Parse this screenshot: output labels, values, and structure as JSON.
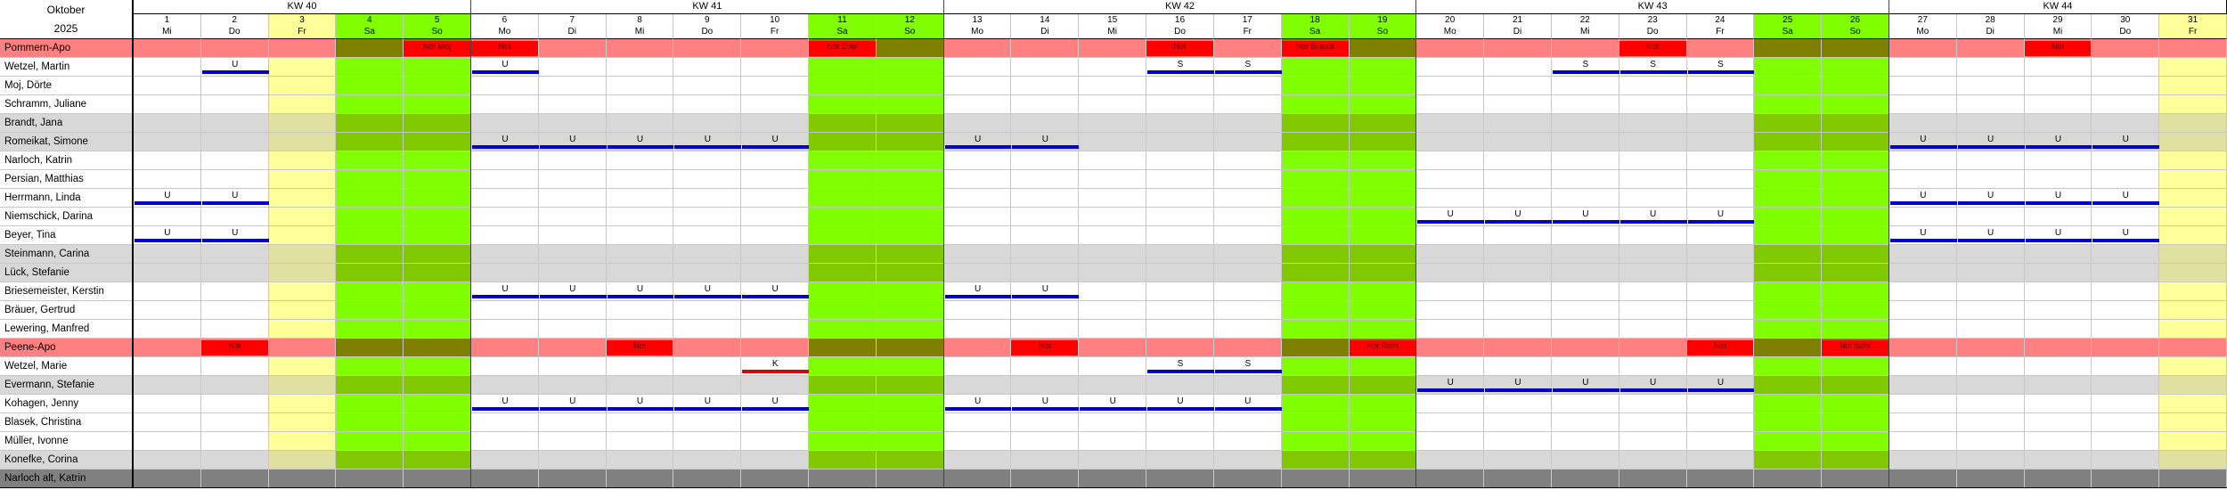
{
  "month": "Oktober",
  "year": "2025",
  "weeks": [
    {
      "label": "KW 40",
      "start": 0,
      "span": 5
    },
    {
      "label": "KW 41",
      "start": 5,
      "span": 7
    },
    {
      "label": "KW 42",
      "start": 12,
      "span": 7
    },
    {
      "label": "KW 43",
      "start": 19,
      "span": 7
    },
    {
      "label": "KW 44",
      "start": 26,
      "span": 5
    }
  ],
  "days": [
    {
      "n": "1",
      "w": "Mi"
    },
    {
      "n": "2",
      "w": "Do"
    },
    {
      "n": "3",
      "w": "Fr",
      "t": "hol"
    },
    {
      "n": "4",
      "w": "Sa",
      "t": "we"
    },
    {
      "n": "5",
      "w": "So",
      "t": "we"
    },
    {
      "n": "6",
      "w": "Mo"
    },
    {
      "n": "7",
      "w": "Di"
    },
    {
      "n": "8",
      "w": "Mi"
    },
    {
      "n": "9",
      "w": "Do"
    },
    {
      "n": "10",
      "w": "Fr"
    },
    {
      "n": "11",
      "w": "Sa",
      "t": "we"
    },
    {
      "n": "12",
      "w": "So",
      "t": "we"
    },
    {
      "n": "13",
      "w": "Mo"
    },
    {
      "n": "14",
      "w": "Di"
    },
    {
      "n": "15",
      "w": "Mi"
    },
    {
      "n": "16",
      "w": "Do"
    },
    {
      "n": "17",
      "w": "Fr"
    },
    {
      "n": "18",
      "w": "Sa",
      "t": "we"
    },
    {
      "n": "19",
      "w": "So",
      "t": "we"
    },
    {
      "n": "20",
      "w": "Mo"
    },
    {
      "n": "21",
      "w": "Di"
    },
    {
      "n": "22",
      "w": "Mi"
    },
    {
      "n": "23",
      "w": "Do"
    },
    {
      "n": "24",
      "w": "Fr"
    },
    {
      "n": "25",
      "w": "Sa",
      "t": "we"
    },
    {
      "n": "26",
      "w": "So",
      "t": "we"
    },
    {
      "n": "27",
      "w": "Mo"
    },
    {
      "n": "28",
      "w": "Di"
    },
    {
      "n": "29",
      "w": "Mi"
    },
    {
      "n": "30",
      "w": "Do"
    },
    {
      "n": "31",
      "w": "Fr",
      "t": "hol"
    }
  ],
  "colors": {
    "weekend": "#80ff00",
    "weekend_gray": "#80c800",
    "holiday": "#ffff99",
    "holiday_gray": "#e0e0a0",
    "group": "#ff8080",
    "group_weekend": "#808000",
    "gray_row": "#d8d8d8",
    "dark_row": "#808080",
    "urlaub": "#0000cc",
    "krank": "#dd0000",
    "not": "#ff0000"
  },
  "rows": [
    {
      "name": "Pommern-Apo",
      "type": "group",
      "notes": [
        {
          "d": 4,
          "text": "Not Moj"
        },
        {
          "d": 5,
          "text": "Not"
        },
        {
          "d": 10,
          "text": "Not Ever"
        },
        {
          "d": 15,
          "text": "Not"
        },
        {
          "d": 17,
          "text": "Not Braudt"
        },
        {
          "d": 22,
          "text": "Not"
        },
        {
          "d": 28,
          "text": "Not"
        }
      ]
    },
    {
      "name": "Wetzel, Martin",
      "type": "white",
      "marks": [
        {
          "d": 1,
          "c": "U"
        },
        {
          "d": 5,
          "c": "U"
        },
        {
          "d": 15,
          "c": "S"
        },
        {
          "d": 16,
          "c": "S"
        },
        {
          "d": 21,
          "c": "S"
        },
        {
          "d": 22,
          "c": "S"
        },
        {
          "d": 23,
          "c": "S"
        }
      ]
    },
    {
      "name": "Moj, Dörte",
      "type": "white",
      "marks": []
    },
    {
      "name": "Schramm, Juliane",
      "type": "white",
      "marks": []
    },
    {
      "name": "Brandt, Jana",
      "type": "gray",
      "marks": []
    },
    {
      "name": "Romeikat, Simone",
      "type": "gray",
      "marks": [
        {
          "d": 5,
          "c": "U"
        },
        {
          "d": 6,
          "c": "U"
        },
        {
          "d": 7,
          "c": "U"
        },
        {
          "d": 8,
          "c": "U"
        },
        {
          "d": 9,
          "c": "U"
        },
        {
          "d": 12,
          "c": "U"
        },
        {
          "d": 13,
          "c": "U"
        },
        {
          "d": 26,
          "c": "U"
        },
        {
          "d": 27,
          "c": "U"
        },
        {
          "d": 28,
          "c": "U"
        },
        {
          "d": 29,
          "c": "U"
        }
      ]
    },
    {
      "name": "Narloch, Katrin",
      "type": "white",
      "marks": []
    },
    {
      "name": "Persian, Matthias",
      "type": "white",
      "marks": []
    },
    {
      "name": "Herrmann, Linda",
      "type": "white",
      "marks": [
        {
          "d": 0,
          "c": "U"
        },
        {
          "d": 1,
          "c": "U"
        },
        {
          "d": 26,
          "c": "U"
        },
        {
          "d": 27,
          "c": "U"
        },
        {
          "d": 28,
          "c": "U"
        },
        {
          "d": 29,
          "c": "U"
        }
      ]
    },
    {
      "name": "Niemschick, Darina",
      "type": "white",
      "marks": [
        {
          "d": 19,
          "c": "U"
        },
        {
          "d": 20,
          "c": "U"
        },
        {
          "d": 21,
          "c": "U"
        },
        {
          "d": 22,
          "c": "U"
        },
        {
          "d": 23,
          "c": "U"
        }
      ]
    },
    {
      "name": "Beyer, Tina",
      "type": "white",
      "marks": [
        {
          "d": 0,
          "c": "U"
        },
        {
          "d": 1,
          "c": "U"
        },
        {
          "d": 26,
          "c": "U"
        },
        {
          "d": 27,
          "c": "U"
        },
        {
          "d": 28,
          "c": "U"
        },
        {
          "d": 29,
          "c": "U"
        }
      ]
    },
    {
      "name": "Steinmann, Carina",
      "type": "gray",
      "marks": []
    },
    {
      "name": "Lück, Stefanie",
      "type": "gray",
      "marks": []
    },
    {
      "name": "Briesemeister, Kerstin",
      "type": "white",
      "marks": [
        {
          "d": 5,
          "c": "U"
        },
        {
          "d": 6,
          "c": "U"
        },
        {
          "d": 7,
          "c": "U"
        },
        {
          "d": 8,
          "c": "U"
        },
        {
          "d": 9,
          "c": "U"
        },
        {
          "d": 12,
          "c": "U"
        },
        {
          "d": 13,
          "c": "U"
        }
      ]
    },
    {
      "name": "Bräuer, Gertrud",
      "type": "white",
      "marks": []
    },
    {
      "name": "Lewering, Manfred",
      "type": "white",
      "marks": []
    },
    {
      "name": "Peene-Apo",
      "type": "group",
      "notes": [
        {
          "d": 1,
          "text": "Not"
        },
        {
          "d": 7,
          "text": "Not"
        },
        {
          "d": 13,
          "text": "Not"
        },
        {
          "d": 18,
          "text": "Not Rom"
        },
        {
          "d": 23,
          "text": "Not"
        },
        {
          "d": 25,
          "text": "Not Schr"
        }
      ]
    },
    {
      "name": "Wetzel, Marie",
      "type": "white",
      "marks": [
        {
          "d": 9,
          "c": "K"
        },
        {
          "d": 15,
          "c": "S"
        },
        {
          "d": 16,
          "c": "S"
        }
      ]
    },
    {
      "name": "Evermann, Stefanie",
      "type": "gray",
      "marks": [
        {
          "d": 19,
          "c": "U"
        },
        {
          "d": 20,
          "c": "U"
        },
        {
          "d": 21,
          "c": "U"
        },
        {
          "d": 22,
          "c": "U"
        },
        {
          "d": 23,
          "c": "U"
        }
      ]
    },
    {
      "name": "Kohagen, Jenny",
      "type": "white",
      "marks": [
        {
          "d": 5,
          "c": "U"
        },
        {
          "d": 6,
          "c": "U"
        },
        {
          "d": 7,
          "c": "U"
        },
        {
          "d": 8,
          "c": "U"
        },
        {
          "d": 9,
          "c": "U"
        },
        {
          "d": 12,
          "c": "U"
        },
        {
          "d": 13,
          "c": "U"
        },
        {
          "d": 14,
          "c": "U"
        },
        {
          "d": 15,
          "c": "U"
        },
        {
          "d": 16,
          "c": "U"
        }
      ]
    },
    {
      "name": "Blasek, Christina",
      "type": "white",
      "marks": []
    },
    {
      "name": "Müller, Ivonne",
      "type": "white",
      "marks": []
    },
    {
      "name": "Konefke, Corina",
      "type": "gray",
      "marks": []
    },
    {
      "name": "Narloch alt, Katrin",
      "type": "dark",
      "marks": []
    }
  ]
}
